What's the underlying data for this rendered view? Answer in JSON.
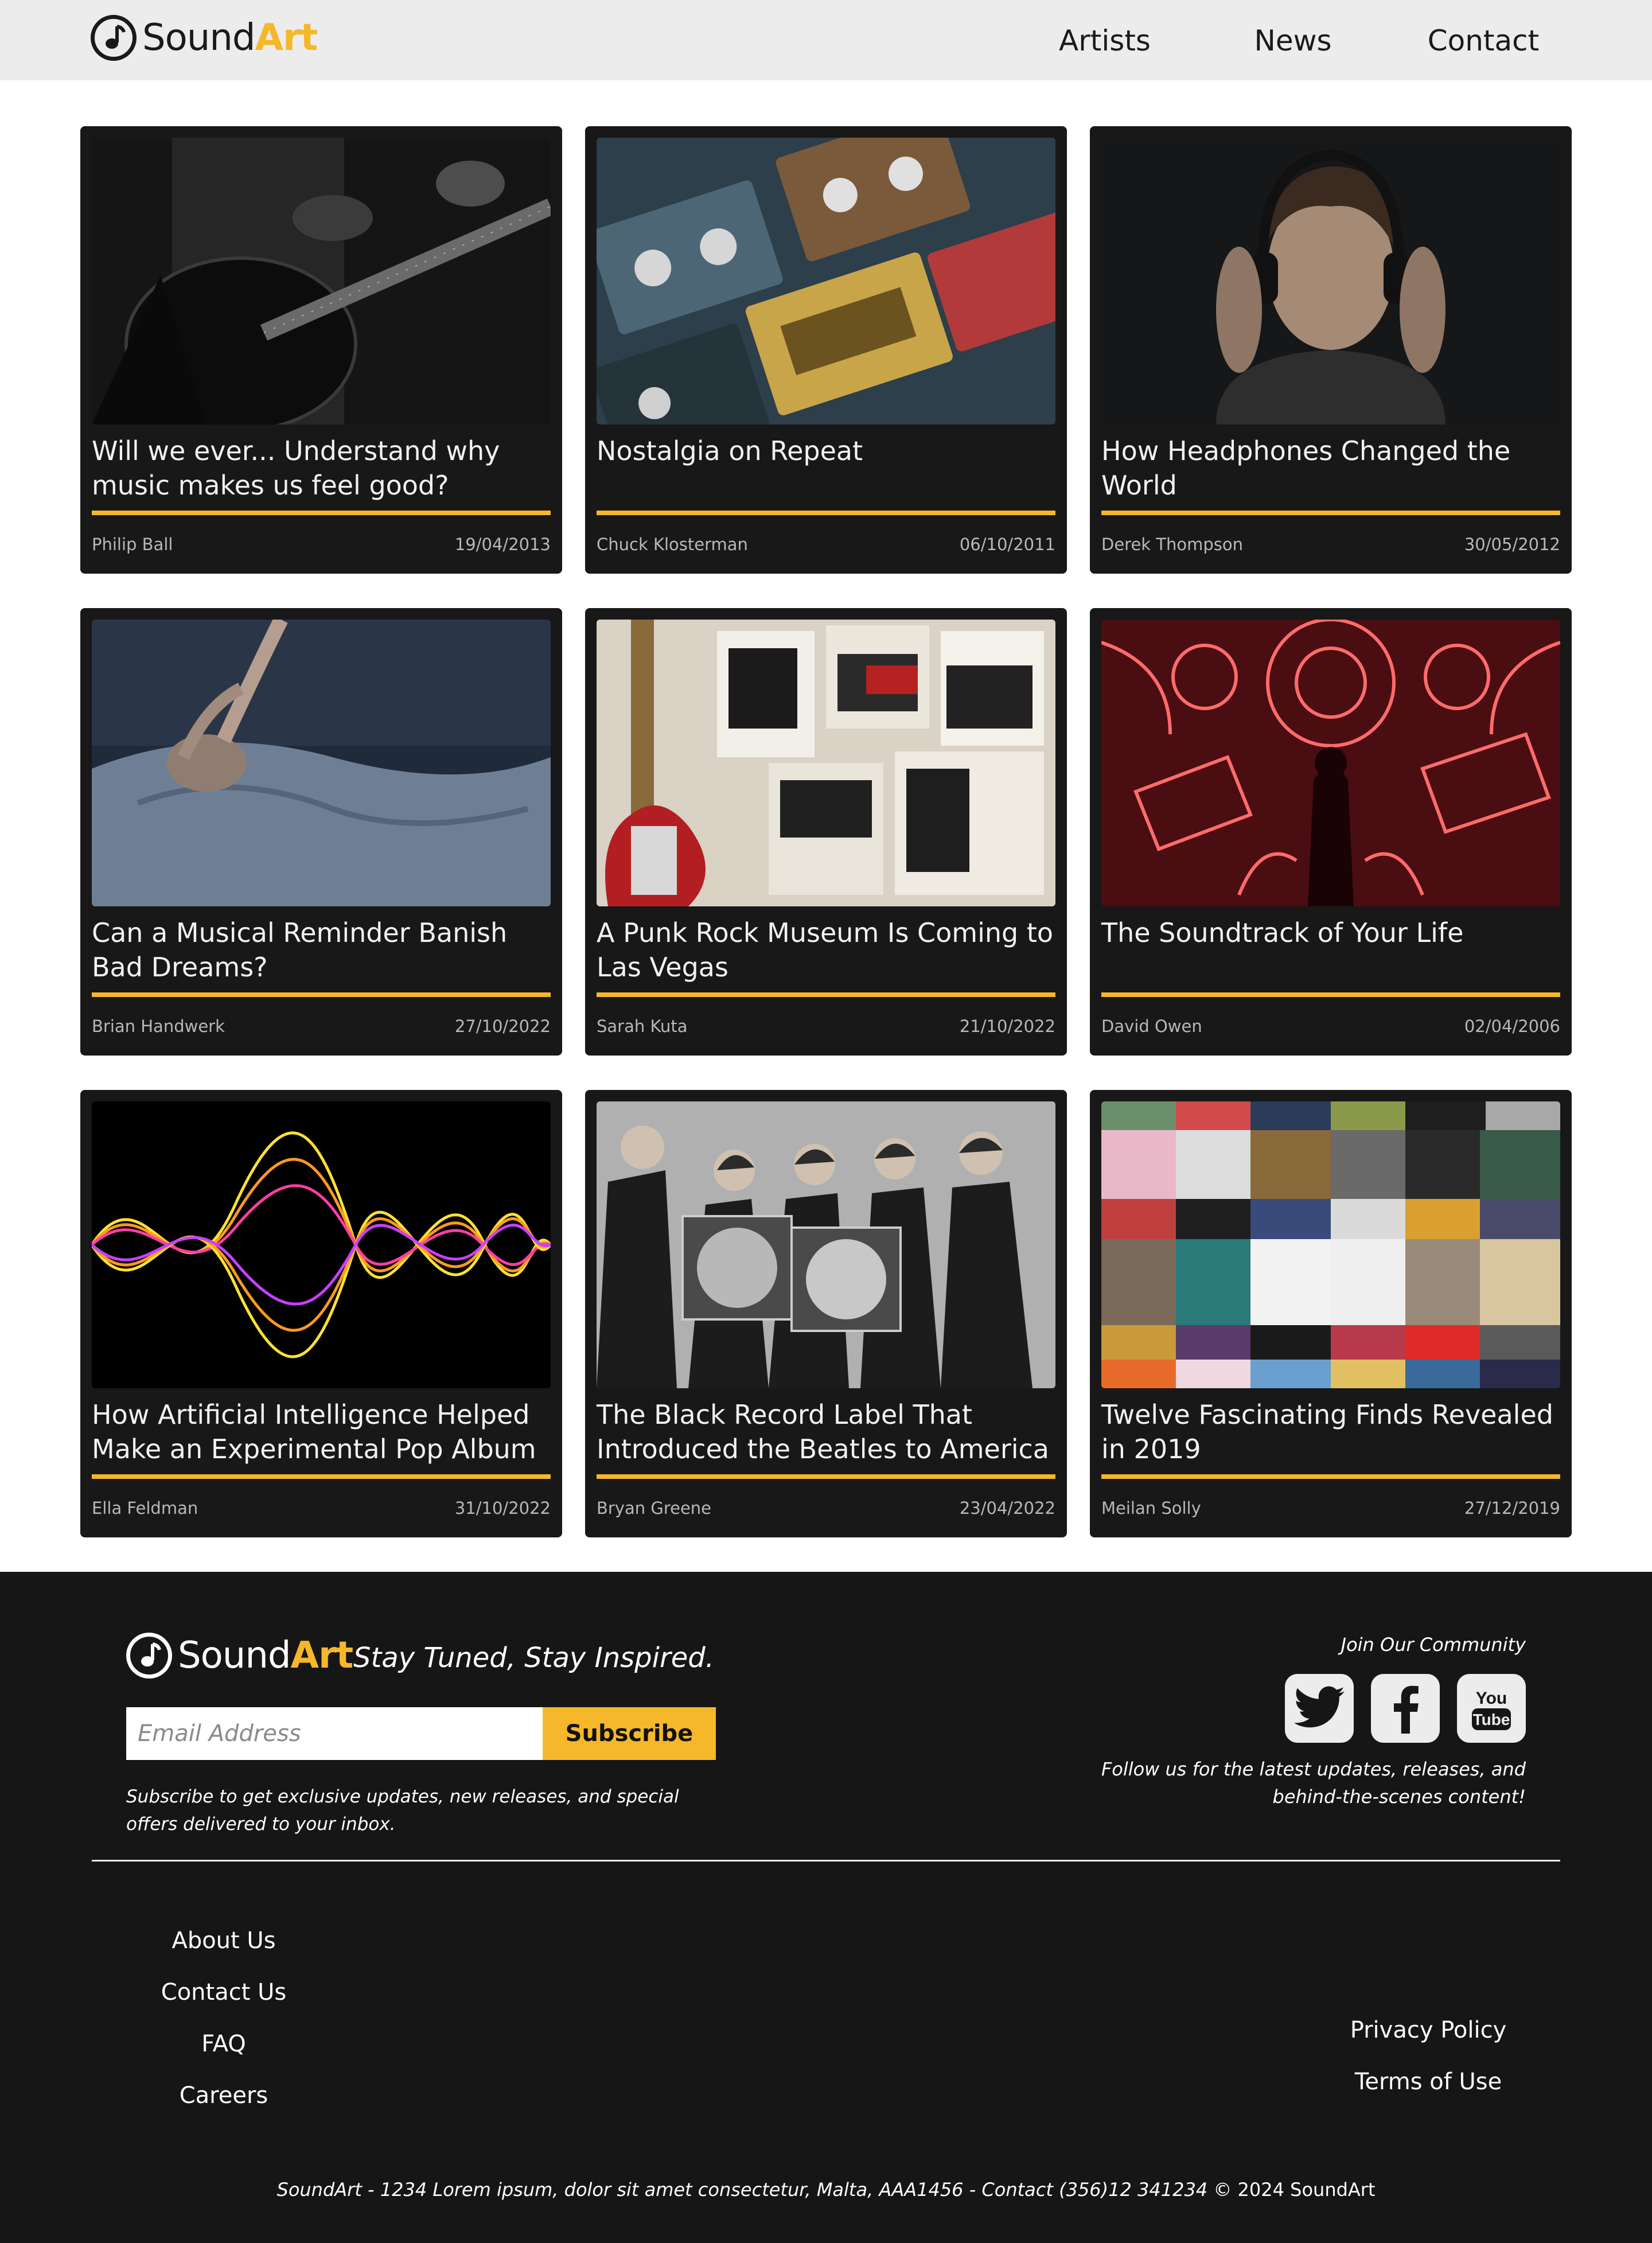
{
  "brand": {
    "word1": "Sound",
    "word2": "Art",
    "accent": "#f5b82b"
  },
  "nav": [
    {
      "label": "Artists"
    },
    {
      "label": "News"
    },
    {
      "label": "Contact"
    }
  ],
  "cards": [
    {
      "title": "Will we ever... Understand why music makes us feel good?",
      "author": "Philip Ball",
      "date": "19/04/2013",
      "image": "guitarist-photo"
    },
    {
      "title": "Nostalgia on Repeat",
      "author": "Chuck Klosterman",
      "date": "06/10/2011",
      "image": "cassette-tapes-photo"
    },
    {
      "title": "How Headphones Changed the World",
      "author": "Derek Thompson",
      "date": "30/05/2012",
      "image": "man-with-headphones-photo"
    },
    {
      "title": "Can a Musical Reminder Banish Bad Dreams?",
      "author": "Brian Handwerk",
      "date": "27/10/2022",
      "image": "person-in-bed-photo"
    },
    {
      "title": "A Punk Rock Museum Is Coming to Las Vegas",
      "author": "Sarah Kuta",
      "date": "21/10/2022",
      "image": "punk-posters-bass-photo"
    },
    {
      "title": "The Soundtrack of Your Life",
      "author": "David Owen",
      "date": "02/04/2006",
      "image": "neon-instruments-illustration"
    },
    {
      "title": "How Artificial Intelligence Helped Make an Experimental Pop Album",
      "author": "Ella Feldman",
      "date": "31/10/2022",
      "image": "neon-sound-wave-illustration"
    },
    {
      "title": "The Black Record Label That Introduced the Beatles to America",
      "author": "Bryan Greene",
      "date": "23/04/2022",
      "image": "band-with-records-photo"
    },
    {
      "title": "Twelve Fascinating Finds Revealed in 2019",
      "author": "Meilan Solly",
      "date": "27/12/2019",
      "image": "album-covers-collage"
    }
  ],
  "footer": {
    "tagline": "Stay Tuned, Stay Inspired.",
    "email_placeholder": "Email Address",
    "subscribe_label": "Subscribe",
    "subscribe_note": "Subscribe to get exclusive updates, new releases, and special offers delivered to your inbox.",
    "join_label": "Join Our Community",
    "socials": [
      "twitter-icon",
      "facebook-icon",
      "youtube-icon"
    ],
    "youtube_you": "You",
    "youtube_tube": "Tube",
    "follow_note": "Follow us for the latest updates, releases, and behind-the-scenes content!",
    "links_left": [
      "About Us",
      "Contact Us",
      "FAQ",
      "Careers"
    ],
    "links_right": [
      "Privacy Policy",
      "Terms of Use"
    ],
    "address": "SoundArt - 1234 Lorem ipsum, dolor sit amet consectetur, Malta, AAA1456 - Contact (356)12 341234",
    "copyright": "© 2024 SoundArt"
  }
}
